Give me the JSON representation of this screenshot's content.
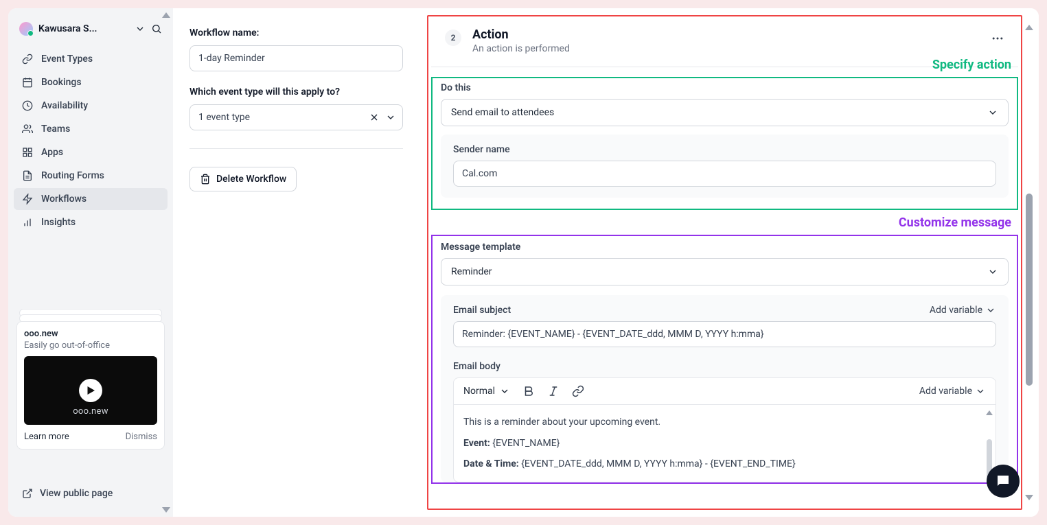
{
  "sidebar": {
    "user_name": "Kawusara S...",
    "nav": [
      {
        "label": "Event Types",
        "icon": "link"
      },
      {
        "label": "Bookings",
        "icon": "calendar"
      },
      {
        "label": "Availability",
        "icon": "clock"
      },
      {
        "label": "Teams",
        "icon": "users"
      },
      {
        "label": "Apps",
        "icon": "grid"
      },
      {
        "label": "Routing Forms",
        "icon": "file"
      },
      {
        "label": "Workflows",
        "icon": "zap",
        "active": true
      },
      {
        "label": "Insights",
        "icon": "bar"
      }
    ],
    "promo": {
      "title": "ooo.new",
      "subtitle": "Easily go out-of-office",
      "video_caption": "ooo.new",
      "learn_more": "Learn more",
      "dismiss": "Dismiss"
    },
    "view_public": "View public page"
  },
  "middle": {
    "workflow_name_label": "Workflow name:",
    "workflow_name_value": "1-day Reminder",
    "event_type_label": "Which event type will this apply to?",
    "event_type_value": "1 event type",
    "delete_workflow": "Delete Workflow"
  },
  "main": {
    "step_number": "2",
    "step_title": "Action",
    "step_subtitle": "An action is performed",
    "specify_action_callout": "Specify action",
    "customize_message_callout": "Customize message",
    "do_this_label": "Do this",
    "do_this_value": "Send email to attendees",
    "sender_name_label": "Sender name",
    "sender_name_value": "Cal.com",
    "template_label": "Message template",
    "template_value": "Reminder",
    "subject_label": "Email subject",
    "add_variable": "Add variable",
    "subject_value": "Reminder: {EVENT_NAME} - {EVENT_DATE_ddd, MMM D, YYYY h:mma}",
    "body_label": "Email body",
    "body_style_label": "Normal",
    "body_line1": "This is a reminder about your upcoming event.",
    "body_line2_label": "Event: ",
    "body_line2_value": "{EVENT_NAME}",
    "body_line3_label": "Date & Time: ",
    "body_line3_value": "{EVENT_DATE_ddd, MMM D, YYYY h:mma} - {EVENT_END_TIME}"
  }
}
